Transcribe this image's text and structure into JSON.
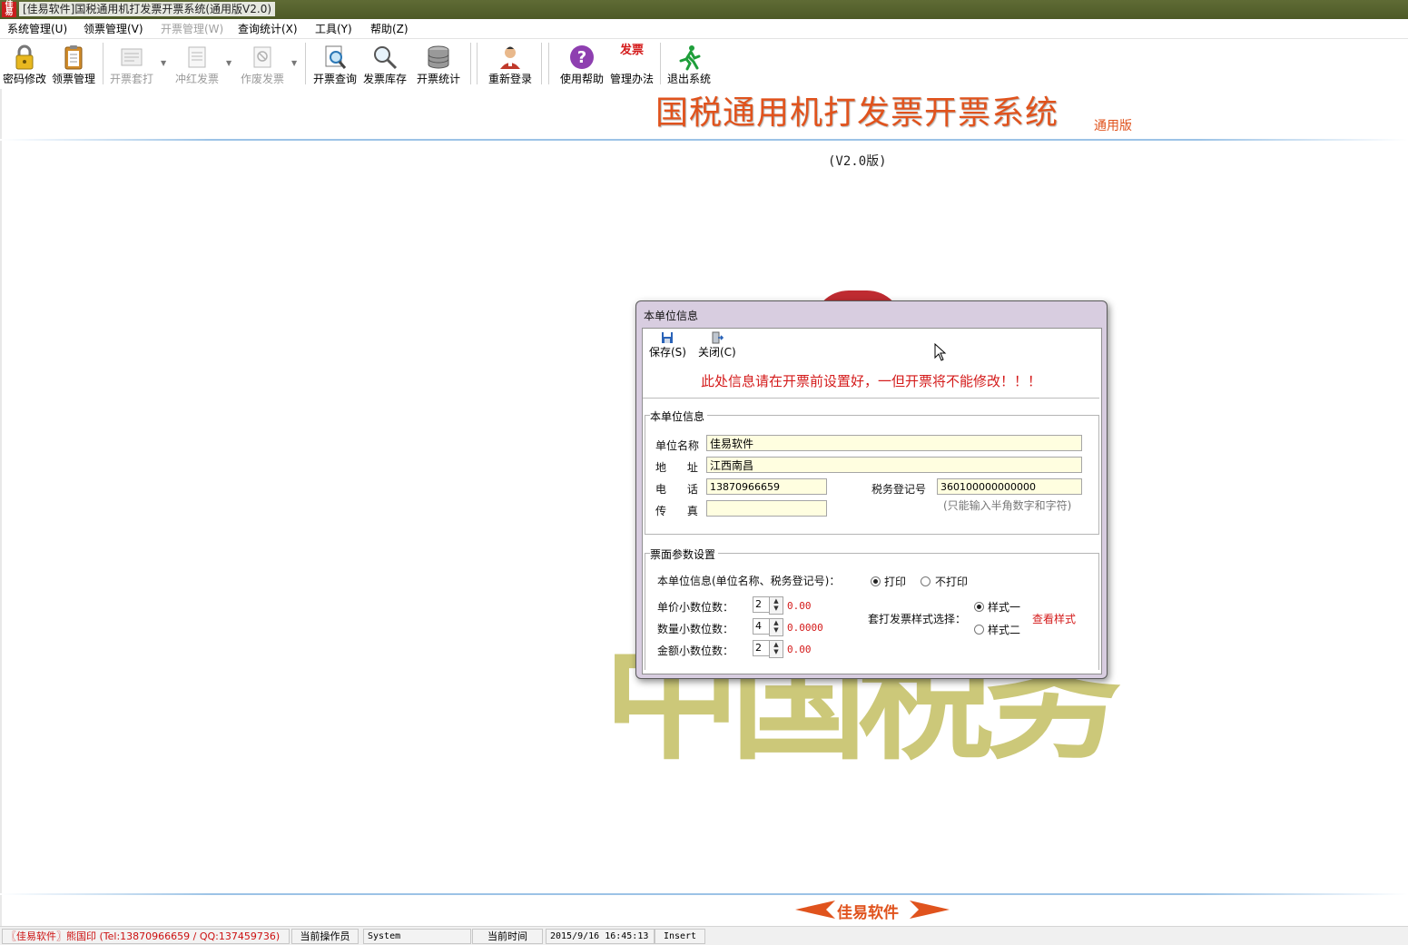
{
  "window": {
    "title": "[佳易软件]国税通用机打发票开票系统(通用版V2.0)",
    "icon_text": "佳易"
  },
  "menu": [
    {
      "label": "系统管理(U)",
      "enabled": true
    },
    {
      "label": "领票管理(V)",
      "enabled": true
    },
    {
      "label": "开票管理(W)",
      "enabled": false
    },
    {
      "label": "查询统计(X)",
      "enabled": true
    },
    {
      "label": "工具(Y)",
      "enabled": true
    },
    {
      "label": "帮助(Z)",
      "enabled": true
    }
  ],
  "toolbar": {
    "password": "密码修改",
    "receive": "领票管理",
    "print_set": "开票套打",
    "red_invoice": "冲红发票",
    "void_invoice": "作废发票",
    "query": "开票查询",
    "stock": "发票库存",
    "stats": "开票统计",
    "relogin": "重新登录",
    "help": "使用帮助",
    "rules": "管理办法",
    "rules_icon_text": "发票",
    "exit": "退出系统"
  },
  "header": {
    "heading": "国税通用机打发票开票系统",
    "heading_sub": "通用版",
    "version": "(V2.0版)"
  },
  "watermark": {
    "text": "中国税务"
  },
  "footer": {
    "logo_text": "佳易软件"
  },
  "status": {
    "company": "〖佳易软件〗熊国印 (Tel:13870966659 / QQ:137459736)",
    "operator_label": "当前操作员",
    "operator": "System",
    "time_label": "当前时间",
    "time": "2015/9/16  16:45:13",
    "mode": "Insert"
  },
  "dialog": {
    "title": "本单位信息",
    "save": "保存(S)",
    "close": "关闭(C)",
    "warning": "此处信息请在开票前设置好，一但开票将不能修改！！！",
    "unit_section": {
      "legend": "本单位信息",
      "name_label": "单位名称",
      "name": "佳易软件",
      "address_label": "地      址",
      "address": "江西南昌",
      "phone_label": "电      话",
      "phone": "13870966659",
      "fax_label": "传      真",
      "fax": "",
      "tax_label": "税务登记号",
      "tax_no": "360100000000000",
      "tax_hint": "(只能输入半角数字和字符)"
    },
    "params_section": {
      "legend": "票面参数设置",
      "print_label": "本单位信息(单位名称、税务登记号)：",
      "print_on": "打印",
      "print_off": "不打印",
      "print_selected": "打印",
      "price_label": "单价小数位数：",
      "price_digits": "2",
      "price_sample": "0.00",
      "qty_label": "数量小数位数：",
      "qty_digits": "4",
      "qty_sample": "0.0000",
      "amount_label": "金额小数位数：",
      "amount_digits": "2",
      "amount_sample": "0.00",
      "style_label": "套打发票样式选择：",
      "style1": "样式一",
      "style2": "样式二",
      "style_selected": "样式一",
      "view_style": "查看样式"
    }
  },
  "colors": {
    "accent_red": "#d41b1b",
    "heading_orange": "#e0531d",
    "input_bg": "#fffee0",
    "title_bar": "#556130"
  }
}
